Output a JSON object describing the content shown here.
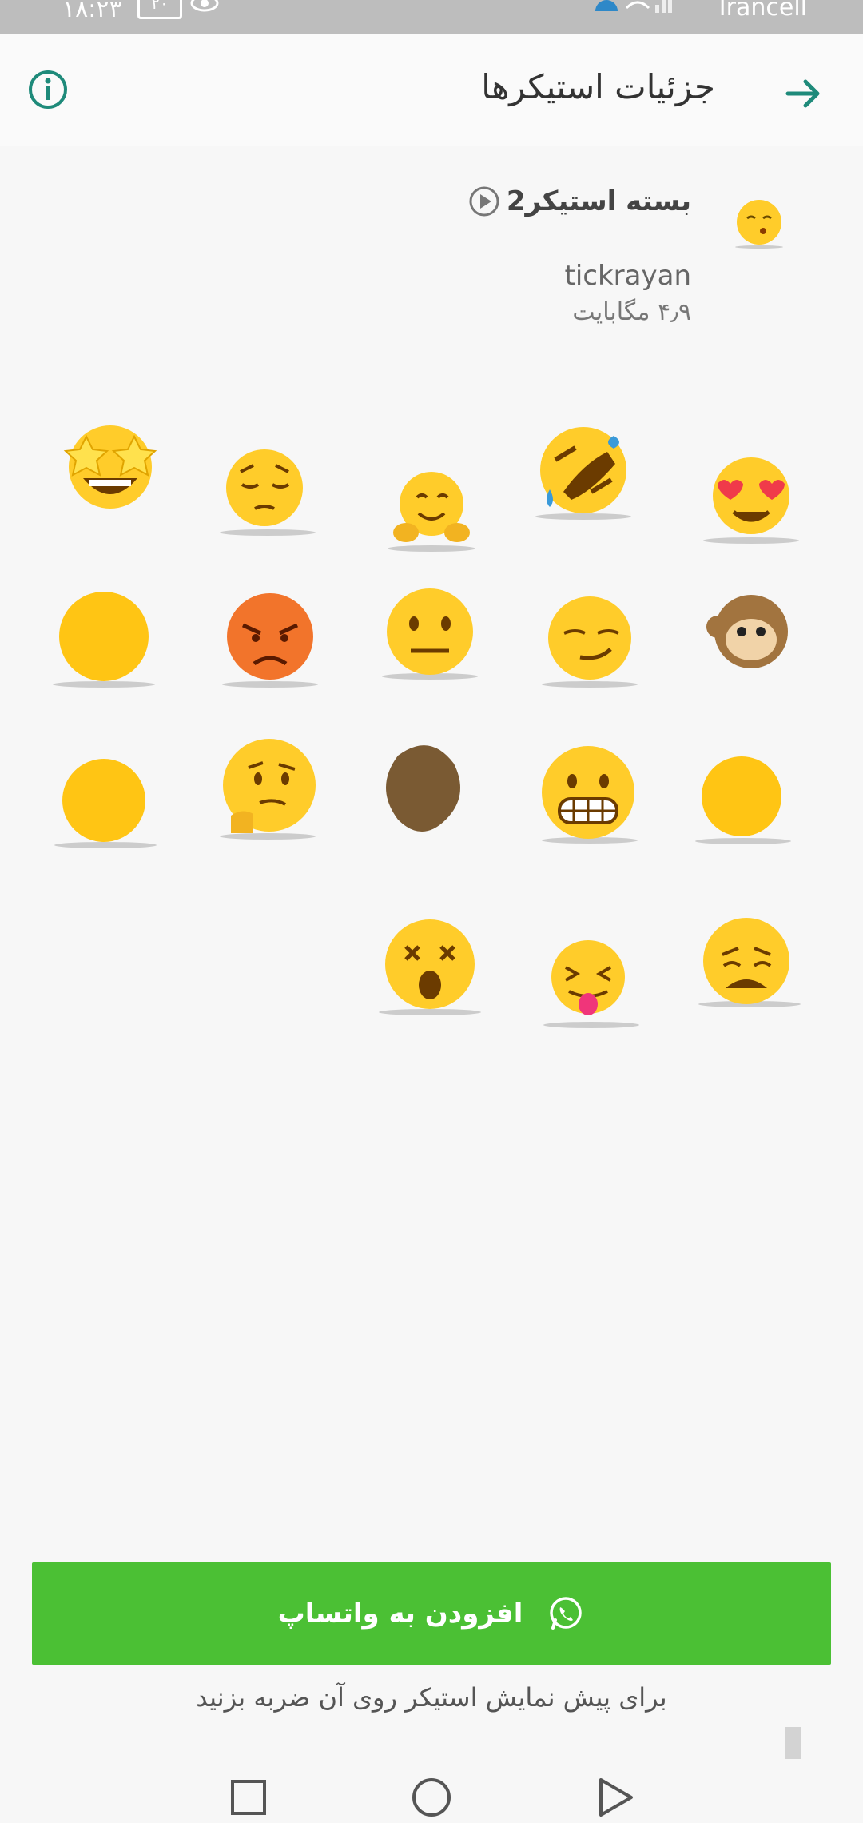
{
  "status_bar": {
    "time": "۱۸:۲۳",
    "battery": "۲۰",
    "carrier": "Irancell"
  },
  "app_bar": {
    "title": "جزئیات استیکرها",
    "info_icon": "info-icon",
    "back_icon": "arrow-right-icon"
  },
  "pack": {
    "name": "بسته استیکر2",
    "publisher": "tickrayan",
    "size": "۴٫۹ مگابایت"
  },
  "stickers": [
    {
      "name": "sticker-heart-eyes",
      "icon": "heart-eyes-emoji"
    },
    {
      "name": "sticker-rofl",
      "icon": "rofl-emoji"
    },
    {
      "name": "sticker-hugging",
      "icon": "hugging-emoji"
    },
    {
      "name": "sticker-pensive",
      "icon": "pensive-emoji"
    },
    {
      "name": "sticker-star-struck",
      "icon": "star-struck-emoji"
    },
    {
      "name": "sticker-monkey",
      "icon": "monkey-emoji"
    },
    {
      "name": "sticker-smirk",
      "icon": "smirk-emoji"
    },
    {
      "name": "sticker-neutral",
      "icon": "neutral-emoji"
    },
    {
      "name": "sticker-angry",
      "icon": "angry-emoji"
    },
    {
      "name": "sticker-blank",
      "icon": "blank-emoji"
    },
    {
      "name": "sticker-blank-small",
      "icon": "blank-emoji"
    },
    {
      "name": "sticker-grimacing",
      "icon": "grimacing-emoji"
    },
    {
      "name": "sticker-brown-blob",
      "icon": "blob-emoji"
    },
    {
      "name": "sticker-thinking",
      "icon": "thinking-emoji"
    },
    {
      "name": "sticker-blank-2",
      "icon": "blank-emoji"
    },
    {
      "name": "sticker-weary",
      "icon": "weary-emoji"
    },
    {
      "name": "sticker-tongue",
      "icon": "squint-tongue-emoji"
    },
    {
      "name": "sticker-dizzy",
      "icon": "dizzy-emoji"
    }
  ],
  "add_button": {
    "label": "افزودن به واتساپ",
    "icon": "whatsapp-icon"
  },
  "hint": "برای پیش نمایش استیکر روی آن ضربه بزنید",
  "nav": {
    "recents_icon": "square-icon",
    "home_icon": "circle-icon",
    "back_icon": "triangle-icon"
  },
  "colors": {
    "accent": "#1e8a7a",
    "add_button": "#4bc034",
    "emoji_yellow": "#ffcc2a"
  }
}
